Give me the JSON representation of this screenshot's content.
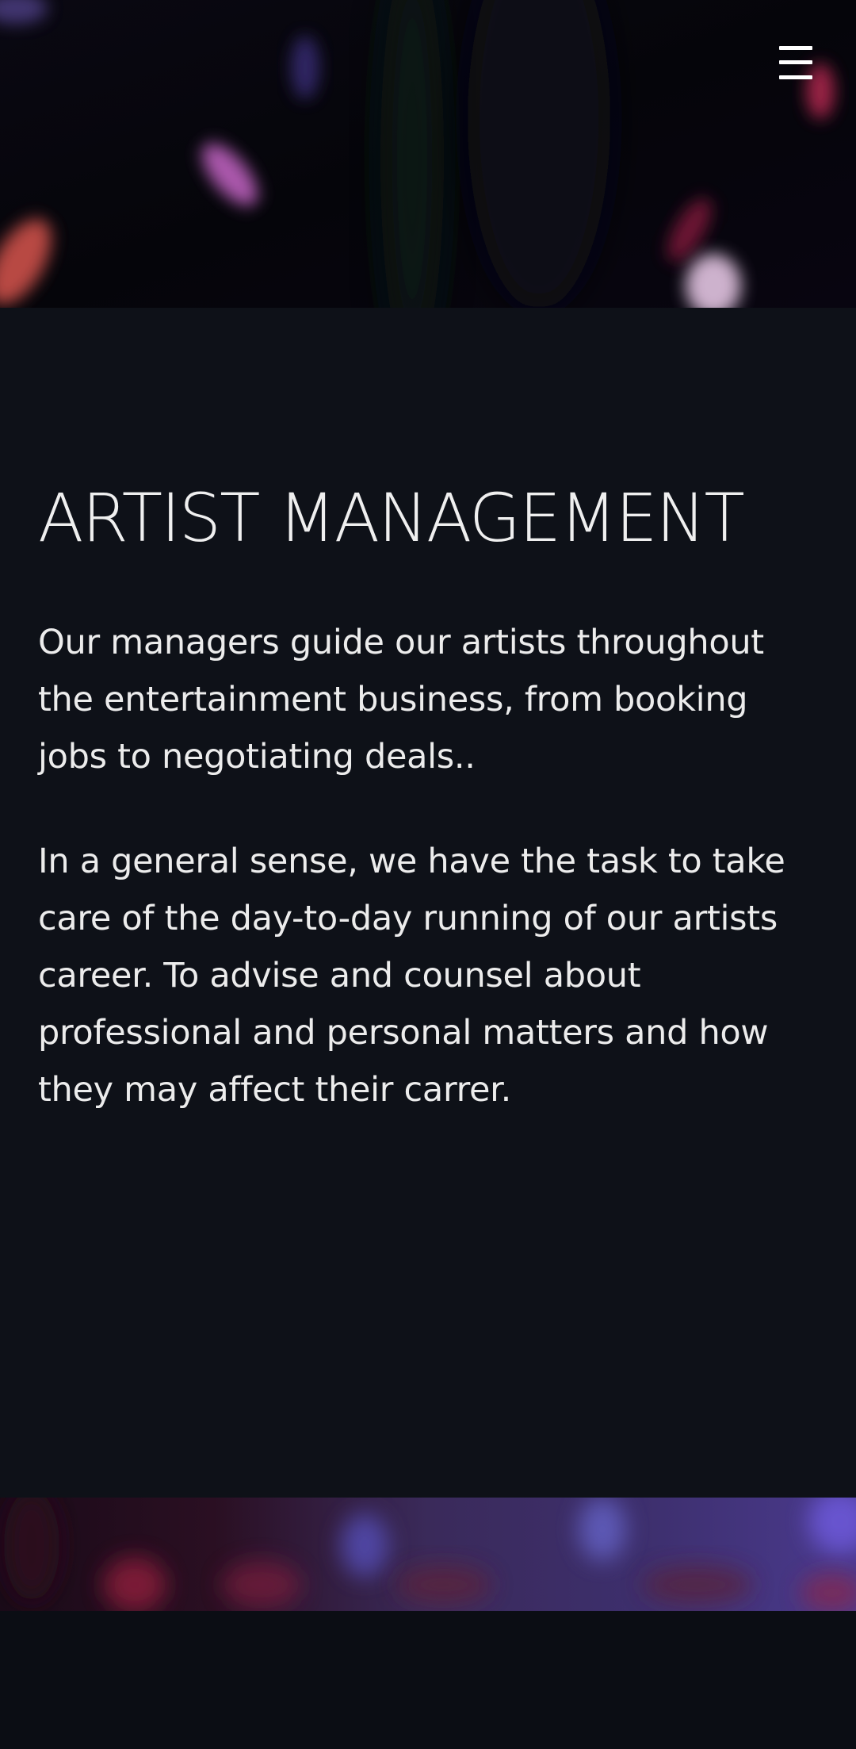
{
  "header": {
    "menu_icon": "hamburger-menu-icon",
    "menu_label": "Menu"
  },
  "main": {
    "title": "ARTIST MANAGEMENT",
    "paragraphs": [
      "Our managers guide our artists throughout the entertainment business, from booking jobs to negotiating deals..",
      "In a general sense, we have the task to take care of the day-to-day running of our artists career. To advise and counsel about professional and personal matters and how they may affect their carrer."
    ]
  },
  "colors": {
    "background": "#0e1118",
    "text": "#f2f2f2",
    "accent_pink": "#c0447e",
    "accent_purple": "#5b4bd6"
  }
}
